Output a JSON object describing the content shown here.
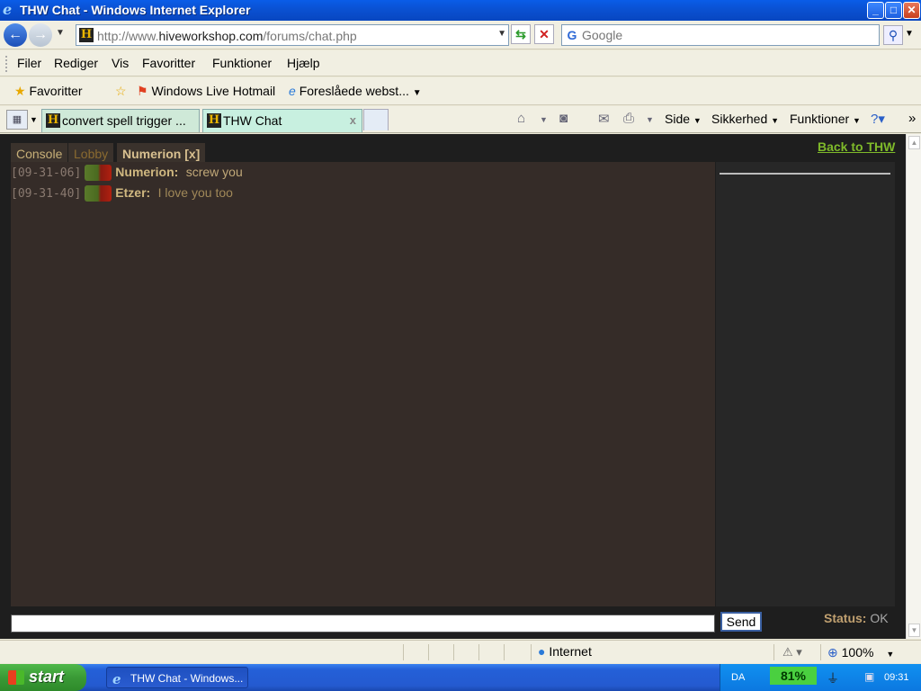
{
  "window": {
    "title": "THW Chat - Windows Internet Explorer",
    "minimize": "_",
    "maximize": "□",
    "close": "✕"
  },
  "address": {
    "url_prefix": "http://www.",
    "url_host": "hiveworkshop.com",
    "url_path": "/forums/chat.php",
    "search_placeholder": "Google"
  },
  "menu": [
    "Filer",
    "Rediger",
    "Vis",
    "Favoritter",
    "Funktioner",
    "Hjælp"
  ],
  "favorites": {
    "favorites_label": "Favoritter",
    "hotmail": "Windows Live Hotmail",
    "suggested": "Foreslåede webst..."
  },
  "tabs": [
    {
      "label": "convert spell trigger ...",
      "active": false
    },
    {
      "label": "THW Chat",
      "active": true
    }
  ],
  "commandbar": {
    "page": "Side",
    "safety": "Sikkerhed",
    "tools": "Funktioner"
  },
  "chat": {
    "back_link": "Back to THW",
    "tabs": [
      "Console",
      "Lobby",
      "Numerion [x]"
    ],
    "messages": [
      {
        "time": "[09-31-06]",
        "nick": "Numerion:",
        "text": "screw you"
      },
      {
        "time": "[09-31-40]",
        "nick": "Etzer:",
        "text": "I love you too"
      }
    ],
    "input_value": "",
    "send_label": "Send",
    "status_label": "Status:",
    "status_value": "OK"
  },
  "statusbar": {
    "zone": "Internet",
    "zoom": "100%"
  },
  "taskbar": {
    "start": "start",
    "item": "THW Chat - Windows...",
    "lang": "DA",
    "battery": "81%",
    "clock": "09:31"
  },
  "colors": {
    "chat_bg": "#352c28",
    "link_green": "#7fba2a",
    "nick_color": "#d0b880"
  }
}
